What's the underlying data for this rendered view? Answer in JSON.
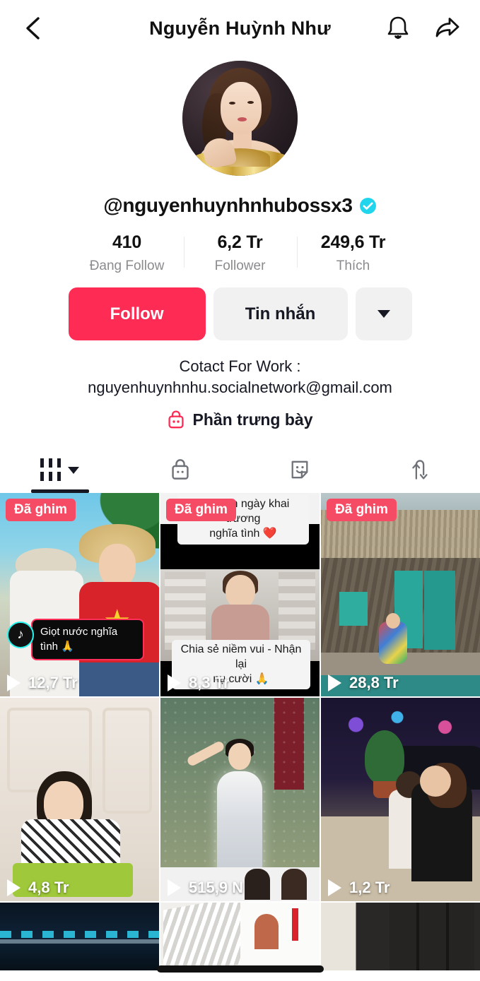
{
  "header": {
    "back_icon": "chevron-left-icon",
    "title": "Nguyễn Huỳnh Như",
    "bell_icon": "bell-icon",
    "share_icon": "share-arrow-icon"
  },
  "profile": {
    "avatar_alt": "profile-avatar",
    "username": "@nguyenhuynhnhubossx3",
    "verified": true,
    "verified_color": "#20D5EC",
    "stats": [
      {
        "value": "410",
        "label": "Đang Follow"
      },
      {
        "value": "6,2 Tr",
        "label": "Follower"
      },
      {
        "value": "249,6 Tr",
        "label": "Thích"
      }
    ],
    "buttons": {
      "follow": "Follow",
      "follow_color": "#FE2C55",
      "message": "Tin nhắn",
      "more_icon": "chevron-down-icon"
    },
    "bio": {
      "line1": "Cotact For Work :",
      "line2": "nguyenhuynhnhu.socialnetwork@gmail.com"
    },
    "showcase": {
      "icon": "shopping-bag-icon",
      "icon_color": "#FE2C55",
      "label": "Phần trưng bày"
    }
  },
  "tabs": [
    {
      "id": "videos",
      "icon": "grid-bars-icon",
      "active": true,
      "has_caret": true
    },
    {
      "id": "shop",
      "icon": "shopping-bag-icon",
      "active": false,
      "has_caret": false
    },
    {
      "id": "effects",
      "icon": "sticker-smiley-icon",
      "active": false,
      "has_caret": false
    },
    {
      "id": "reposts",
      "icon": "repost-arrows-icon",
      "active": false,
      "has_caret": false
    }
  ],
  "videos": [
    {
      "pinned_label": "Đã ghim",
      "views": "12,7 Tr",
      "overlay_dark": "Giọt nước nghĩa tình\n🙏",
      "tiktok_badge": "♪"
    },
    {
      "pinned_label": "Đã ghim",
      "views": "8,3 Tr",
      "caption_top": "Kỷ niệm ngày khai trương\nnghĩa tình ❤️",
      "caption_bottom": "Chia sẻ niềm vui - Nhận lại\nnụ cười 🙏"
    },
    {
      "pinned_label": "Đã ghim",
      "views": "28,8 Tr"
    },
    {
      "views": "4,8 Tr"
    },
    {
      "views": "515,9 N"
    },
    {
      "views": "1,2 Tr"
    }
  ],
  "play_icon": "play-triangle-icon",
  "home_indicator": "home-indicator-bar"
}
